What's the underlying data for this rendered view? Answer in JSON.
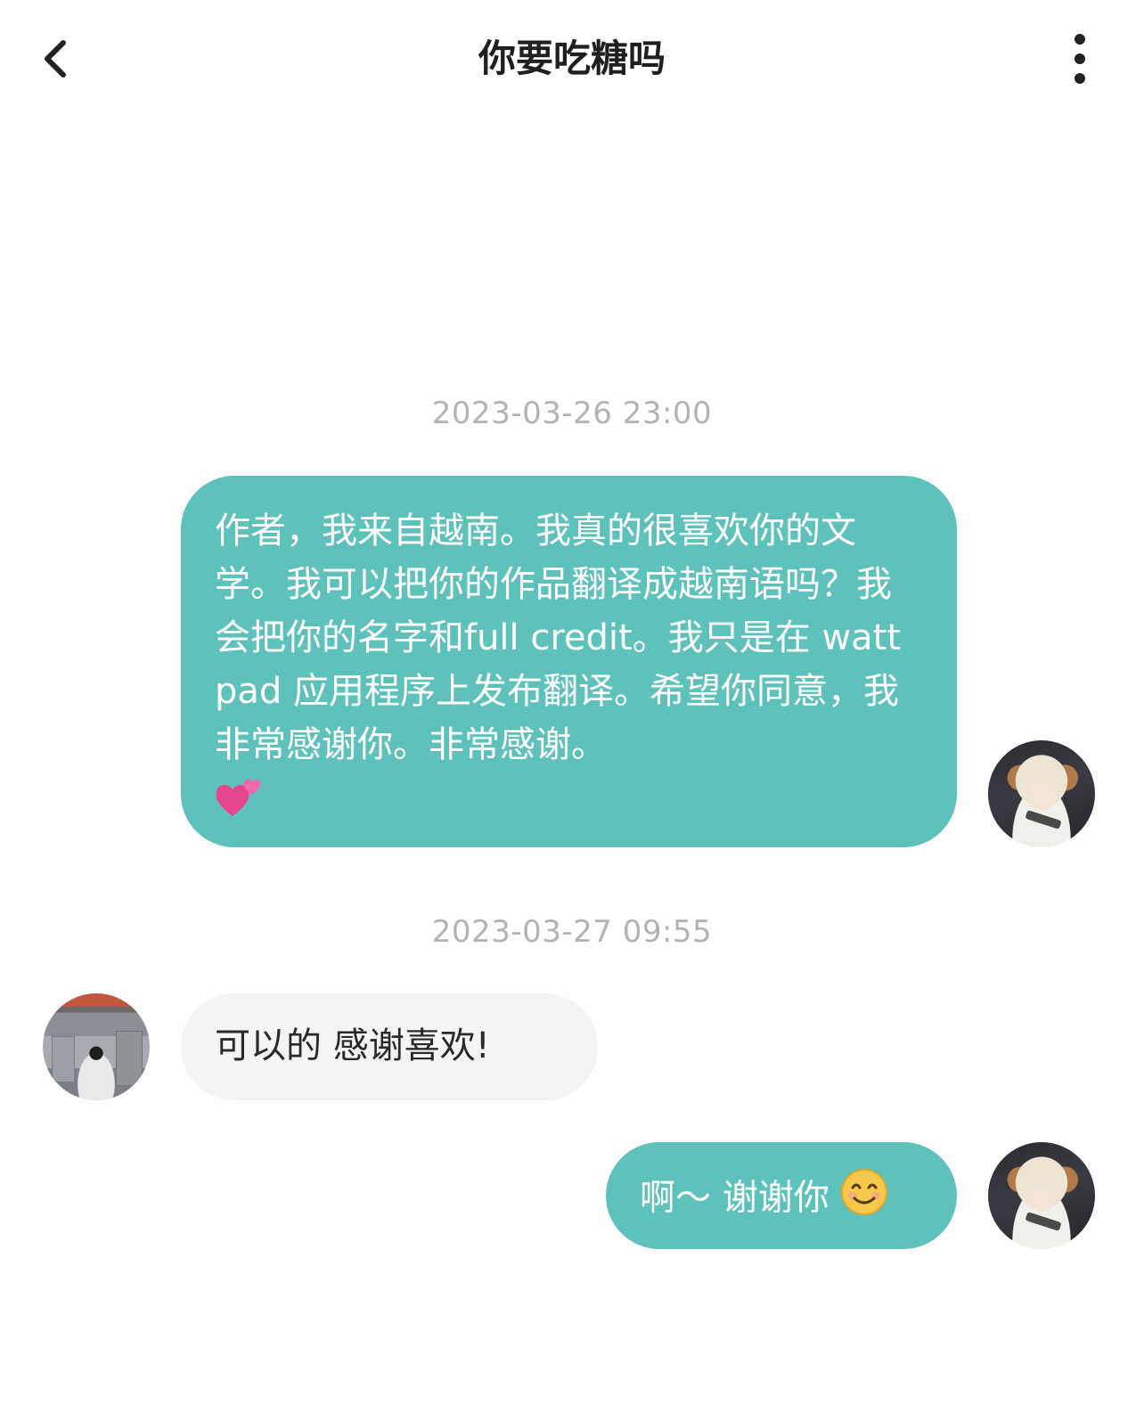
{
  "header": {
    "title": "你要吃糖吗",
    "back_icon": "chevron-left-icon",
    "more_icon": "more-vertical-icon"
  },
  "messages": [
    {
      "timestamp": "2023-03-26 23:00",
      "direction": "outgoing",
      "text": "作者，我来自越南。我真的很喜欢你的文学。我可以把你的作品翻译成越南语吗？我会把你的名字和full credit。我只是在 wattpad 应用程序上发布翻译。希望你同意，我非常感谢你。非常感谢。",
      "emoji": "two-hearts-icon"
    },
    {
      "timestamp": "2023-03-27 09:55",
      "direction": "incoming",
      "text": "可以的 感谢喜欢!"
    },
    {
      "direction": "outgoing",
      "text": "啊～ 谢谢你",
      "emoji": "smiling-face-icon"
    }
  ],
  "colors": {
    "outgoing_bubble": "#5ec2ba",
    "incoming_bubble": "#f4f4f4",
    "timestamp_text": "#b3b3b3",
    "title_text": "#1f1f1f"
  }
}
